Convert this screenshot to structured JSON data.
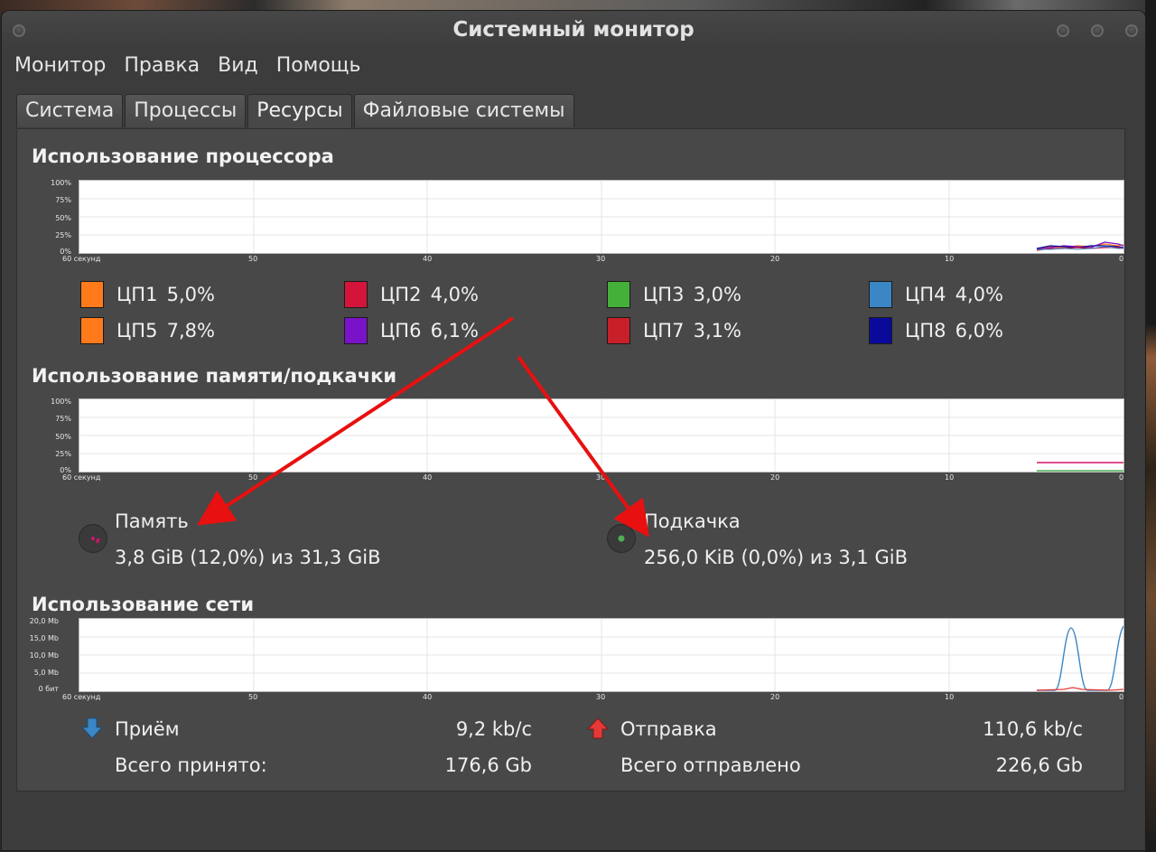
{
  "window": {
    "title": "Системный монитор"
  },
  "menu": [
    "Монитор",
    "Правка",
    "Вид",
    "Помощь"
  ],
  "tabs": [
    {
      "label": "Система",
      "active": false
    },
    {
      "label": "Процессы",
      "active": false
    },
    {
      "label": "Ресурсы",
      "active": true
    },
    {
      "label": "Файловые системы",
      "active": false
    }
  ],
  "cpu": {
    "title": "Использование процессора",
    "y_ticks": [
      "100%",
      "75%",
      "50%",
      "25%",
      "0%"
    ],
    "x_ticks": [
      "60 секунд",
      "50",
      "40",
      "30",
      "20",
      "10",
      "0"
    ],
    "legend": [
      {
        "label": "ЦП1",
        "value": "5,0%",
        "color": "#ff7a1a"
      },
      {
        "label": "ЦП2",
        "value": "4,0%",
        "color": "#d4143a"
      },
      {
        "label": "ЦП3",
        "value": "3,0%",
        "color": "#44b03a"
      },
      {
        "label": "ЦП4",
        "value": "4,0%",
        "color": "#3b86c4"
      },
      {
        "label": "ЦП5",
        "value": "7,8%",
        "color": "#ff7a1a"
      },
      {
        "label": "ЦП6",
        "value": "6,1%",
        "color": "#7a12c8"
      },
      {
        "label": "ЦП7",
        "value": "3,1%",
        "color": "#c8202a"
      },
      {
        "label": "ЦП8",
        "value": "6,0%",
        "color": "#0a0a9a"
      }
    ]
  },
  "memory": {
    "title": "Использование памяти/подкачки",
    "y_ticks": [
      "100%",
      "75%",
      "50%",
      "25%",
      "0%"
    ],
    "x_ticks": [
      "60 секунд",
      "50",
      "40",
      "30",
      "20",
      "10",
      "0"
    ],
    "mem_label": "Память",
    "mem_value": "3,8 GiB (12,0%) из 31,3 GiB",
    "mem_color": "#d4146a",
    "swap_label": "Подкачка",
    "swap_value": "256,0 KiB (0,0%) из 3,1 GiB",
    "swap_color": "#4caf50"
  },
  "network": {
    "title": "Использование сети",
    "y_ticks": [
      "20,0 Mb",
      "15,0 Mb",
      "10,0 Mb",
      "5,0 Mb",
      "0 бит"
    ],
    "x_ticks": [
      "60 секунд",
      "50",
      "40",
      "30",
      "20",
      "10",
      "0"
    ],
    "recv_label": "Приём",
    "recv_rate": "9,2 kb/c",
    "recv_total_label": "Всего принято:",
    "recv_total": "176,6 Gb",
    "send_label": "Отправка",
    "send_rate": "110,6 kb/c",
    "send_total_label": "Всего отправлено",
    "send_total": "226,6 Gb",
    "recv_color": "#3b86c4",
    "send_color": "#e53935"
  }
}
